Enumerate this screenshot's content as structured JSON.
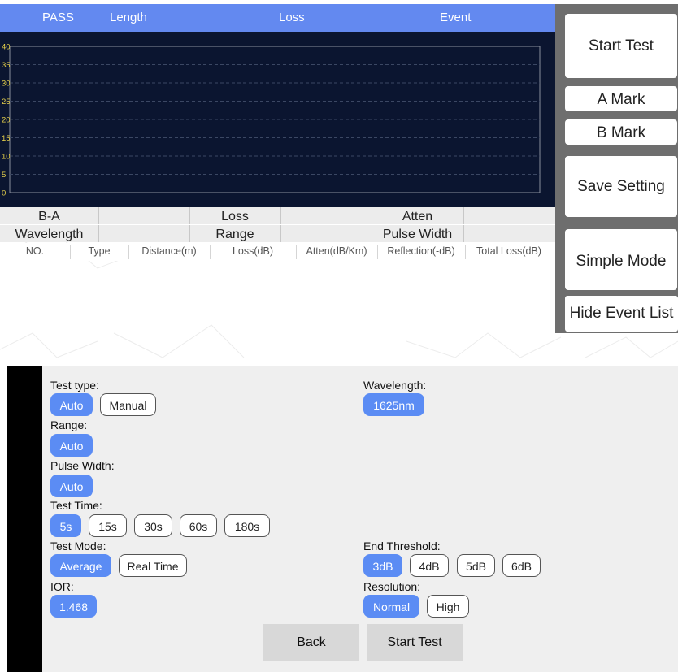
{
  "topbar": {
    "pass": "PASS",
    "length": "Length",
    "loss": "Loss",
    "event": "Event"
  },
  "graph": {
    "y_ticks": [
      "40",
      "35",
      "30",
      "25",
      "20",
      "15",
      "10",
      "5",
      "0"
    ]
  },
  "marker_row": {
    "ba": "B-A",
    "loss": "Loss",
    "atten": "Atten"
  },
  "info_row": {
    "wavelength": "Wavelength",
    "range": "Range",
    "pulse_width": "Pulse Width"
  },
  "event_table": {
    "columns": [
      "NO.",
      "Type",
      "Distance(m)",
      "Loss(dB)",
      "Atten(dB/Km)",
      "Reflection(-dB)",
      "Total Loss(dB)"
    ]
  },
  "right_panel": {
    "start_test": "Start Test",
    "a_mark": "A Mark",
    "b_mark": "B Mark",
    "save_setting": "Save Setting",
    "simple_mode": "Simple Mode",
    "hide_event_list": "Hide Event List"
  },
  "settings": {
    "test_type": {
      "label": "Test type:",
      "options": [
        "Auto",
        "Manual"
      ],
      "selected": "Auto"
    },
    "wavelength": {
      "label": "Wavelength:",
      "options": [
        "1625nm"
      ],
      "selected": "1625nm"
    },
    "range": {
      "label": "Range:",
      "options": [
        "Auto"
      ],
      "selected": "Auto"
    },
    "pulse_width": {
      "label": "Pulse Width:",
      "options": [
        "Auto"
      ],
      "selected": "Auto"
    },
    "test_time": {
      "label": "Test Time:",
      "options": [
        "5s",
        "15s",
        "30s",
        "60s",
        "180s"
      ],
      "selected": "5s"
    },
    "test_mode": {
      "label": "Test Mode:",
      "options": [
        "Average",
        "Real Time"
      ],
      "selected": "Average"
    },
    "end_threshold": {
      "label": "End Threshold:",
      "options": [
        "3dB",
        "4dB",
        "5dB",
        "6dB"
      ],
      "selected": "3dB"
    },
    "ior": {
      "label": "IOR:",
      "options": [
        "1.468"
      ],
      "selected": "1.468"
    },
    "resolution": {
      "label": "Resolution:",
      "options": [
        "Normal",
        "High"
      ],
      "selected": "Normal"
    },
    "back": "Back",
    "start_test": "Start Test"
  },
  "colors": {
    "header_blue": "#6389f0",
    "graph_bg": "#0b1530",
    "tick_yellow": "#e8d24a",
    "chip_selected": "#5b8cf4",
    "panel_gray": "#6e6e6e"
  }
}
